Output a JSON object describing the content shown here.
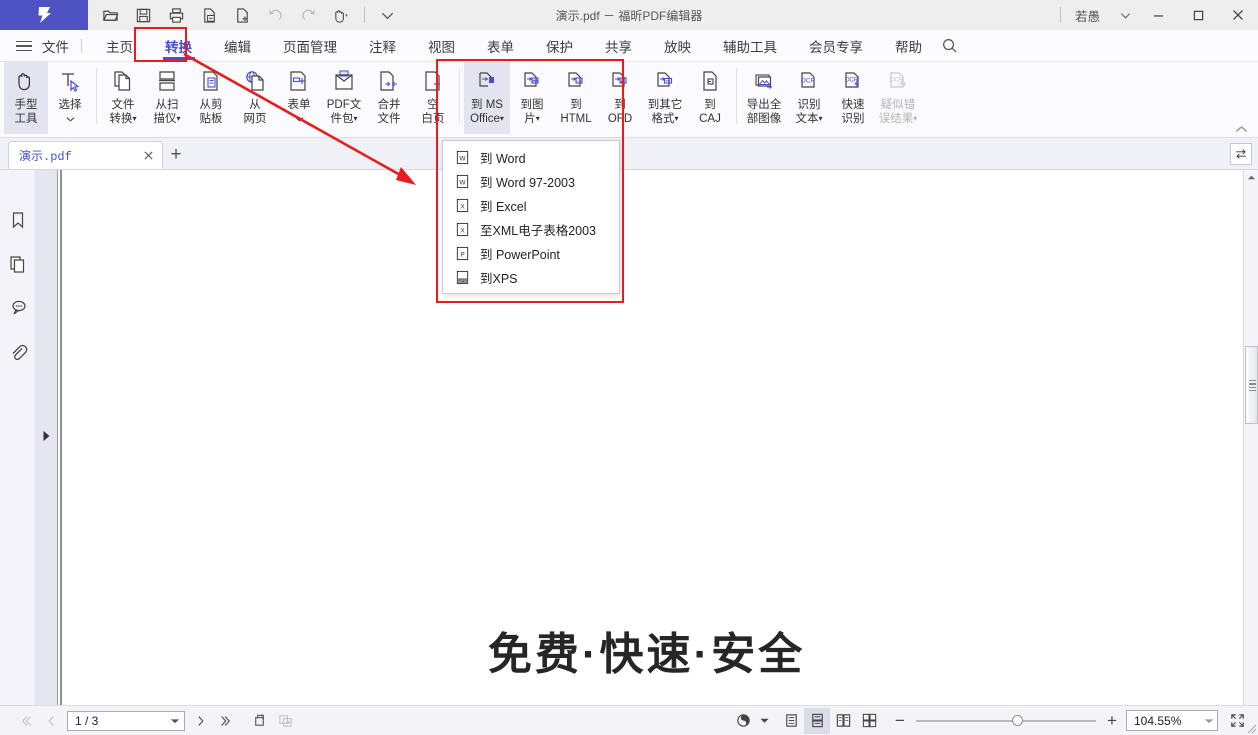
{
  "titlebar": {
    "document_title": "演示.pdf － 福昕PDF编辑器",
    "user_name": "若愚",
    "quick_tools": [
      {
        "name": "open-file",
        "icon": "folder-open-icon"
      },
      {
        "name": "save",
        "icon": "floppy-disk-icon"
      },
      {
        "name": "print",
        "icon": "printer-icon"
      },
      {
        "name": "save-as",
        "icon": "document-minus-icon"
      },
      {
        "name": "new-document",
        "icon": "document-plus-icon"
      },
      {
        "name": "undo",
        "icon": "undo-arrow-icon"
      },
      {
        "name": "redo",
        "icon": "redo-arrow-icon"
      },
      {
        "name": "hand-tool",
        "icon": "hand-pointer-icon"
      }
    ],
    "more_label": "▽",
    "minimize_label": "—",
    "maximize_label": "□",
    "close_label": "✕"
  },
  "menubar": {
    "file_label": "文件",
    "tabs": [
      {
        "label": "主页",
        "active": false
      },
      {
        "label": "转换",
        "active": true
      },
      {
        "label": "编辑",
        "active": false
      },
      {
        "label": "页面管理",
        "active": false
      },
      {
        "label": "注释",
        "active": false
      },
      {
        "label": "视图",
        "active": false
      },
      {
        "label": "表单",
        "active": false
      },
      {
        "label": "保护",
        "active": false
      },
      {
        "label": "共享",
        "active": false
      },
      {
        "label": "放映",
        "active": false
      },
      {
        "label": "辅助工具",
        "active": false
      },
      {
        "label": "会员专享",
        "active": false
      },
      {
        "label": "帮助",
        "active": false
      }
    ]
  },
  "ribbon": {
    "groups": [
      {
        "buttons": [
          {
            "name": "hand-tool",
            "line1": "手型",
            "line2": "工具",
            "icon": "hand-icon",
            "state": "selected",
            "caret": false
          },
          {
            "name": "select-tool",
            "line1": "选择",
            "line2": "",
            "icon": "select-cursor-icon",
            "state": "normal",
            "caret": true
          }
        ]
      },
      {
        "buttons": [
          {
            "name": "convert-from-file",
            "line1": "文件",
            "line2": "转换",
            "icon": "copy-file-icon",
            "state": "normal",
            "caret": true
          },
          {
            "name": "from-scanner",
            "line1": "从扫",
            "line2": "描仪",
            "icon": "scanner-icon",
            "state": "normal",
            "caret": true
          },
          {
            "name": "from-clipboard",
            "line1": "从剪",
            "line2": "贴板",
            "icon": "clipboard-icon",
            "state": "normal",
            "caret": false
          },
          {
            "name": "from-webpage",
            "line1": "从",
            "line2": "网页",
            "icon": "globe-page-icon",
            "state": "normal",
            "caret": false
          },
          {
            "name": "form-create",
            "line1": "表单",
            "line2": "",
            "icon": "form-plus-icon",
            "state": "normal",
            "caret": true
          },
          {
            "name": "pdf-portfolio",
            "line1": "PDF文",
            "line2": "件包",
            "icon": "portfolio-icon",
            "state": "normal",
            "caret": true
          },
          {
            "name": "merge-files",
            "line1": "合并",
            "line2": "文件",
            "icon": "merge-icon",
            "state": "normal",
            "caret": false
          },
          {
            "name": "blank-page",
            "line1": "空",
            "line2": "白页",
            "icon": "blank-page-plus-icon",
            "state": "normal",
            "caret": false
          }
        ]
      },
      {
        "buttons": [
          {
            "name": "to-ms-office",
            "line1": "到 MS",
            "line2": "Office",
            "icon": "to-office-icon",
            "state": "selected",
            "caret": true
          },
          {
            "name": "to-image",
            "line1": "到图",
            "line2": "片",
            "icon": "to-image-icon",
            "state": "normal",
            "caret": true
          },
          {
            "name": "to-html",
            "line1": "到",
            "line2": "HTML",
            "icon": "to-html-icon",
            "state": "normal",
            "caret": false
          },
          {
            "name": "to-ofd",
            "line1": "到",
            "line2": "OFD",
            "icon": "to-ofd-icon",
            "state": "normal",
            "caret": false
          },
          {
            "name": "to-other-format",
            "line1": "到其它",
            "line2": "格式",
            "icon": "to-other-icon",
            "state": "normal",
            "caret": true
          },
          {
            "name": "to-caj",
            "line1": "到",
            "line2": "CAJ",
            "icon": "to-caj-icon",
            "state": "normal",
            "caret": false
          }
        ]
      },
      {
        "buttons": [
          {
            "name": "export-all-images",
            "line1": "导出全",
            "line2": "部图像",
            "icon": "export-images-icon",
            "state": "normal",
            "caret": false
          },
          {
            "name": "recognize-text",
            "line1": "识别",
            "line2": "文本",
            "icon": "ocr-icon",
            "state": "normal",
            "caret": true
          },
          {
            "name": "quick-recognize",
            "line1": "快速",
            "line2": "识别",
            "icon": "ocr-fast-icon",
            "state": "normal",
            "caret": false
          },
          {
            "name": "suspected-errors",
            "line1": "疑似错",
            "line2": "误结果",
            "icon": "ocr-suspect-icon",
            "state": "disabled",
            "caret": true
          }
        ]
      }
    ],
    "collapse_icon": "chevron-up-icon"
  },
  "dropdown": {
    "items": [
      {
        "label": "到 Word",
        "icon": "word-icon"
      },
      {
        "label": "到 Word 97-2003",
        "icon": "word-icon"
      },
      {
        "label": "到 Excel",
        "icon": "excel-icon"
      },
      {
        "label": "至XML电子表格2003",
        "icon": "excel-icon"
      },
      {
        "label": "到 PowerPoint",
        "icon": "powerpoint-icon"
      },
      {
        "label": "到XPS",
        "icon": "xps-icon"
      }
    ]
  },
  "annotations": {
    "highlight_color": "#e81c1c",
    "arrow_from_label": "转换",
    "arrow_to_label": "到 MS Office 菜单"
  },
  "tabbar": {
    "document_tab": "演示.pdf",
    "close_label": "✕",
    "new_tab_label": "+",
    "swap_icon": "swap-arrows-icon"
  },
  "sidebar": {
    "items": [
      {
        "name": "bookmark-panel",
        "icon": "bookmark-icon"
      },
      {
        "name": "page-thumbnails-panel",
        "icon": "pages-icon"
      },
      {
        "name": "comments-panel",
        "icon": "comment-bubble-icon"
      },
      {
        "name": "attachments-panel",
        "icon": "paperclip-icon"
      }
    ],
    "expand_icon": "triangle-right-icon"
  },
  "document": {
    "headline": "免费·快速·安全"
  },
  "statusbar": {
    "first_page_label": "«",
    "prev_page_label": "‹",
    "page_value": "1 / 3",
    "next_page_label": "›",
    "last_page_label": "»",
    "buttons": [
      {
        "name": "rotate-view-button",
        "icon": "rotate-icon",
        "state": "normal"
      },
      {
        "name": "auto-scroll-button",
        "icon": "autoscroll-icon",
        "state": "disabled"
      }
    ],
    "view_modes": [
      {
        "name": "single-page-view",
        "icon": "single-page-icon",
        "state": "normal"
      },
      {
        "name": "continuous-view",
        "icon": "continuous-page-icon",
        "state": "selected"
      },
      {
        "name": "two-page-view",
        "icon": "two-page-icon",
        "state": "normal"
      },
      {
        "name": "two-page-continuous-view",
        "icon": "two-page-continuous-icon",
        "state": "normal"
      }
    ],
    "read_mode_icon": "read-mode-icon",
    "zoom_out_label": "−",
    "zoom_in_label": "+",
    "zoom_value": "104.55%",
    "fullscreen_icon": "fullscreen-icon"
  },
  "colors": {
    "brand_purple": "#4f52c3",
    "accent_blue": "#4a4fd0",
    "annotation_red": "#e81c1c",
    "ribbon_bg": "#fafaff",
    "titlebar_bg": "#eeeeee"
  }
}
